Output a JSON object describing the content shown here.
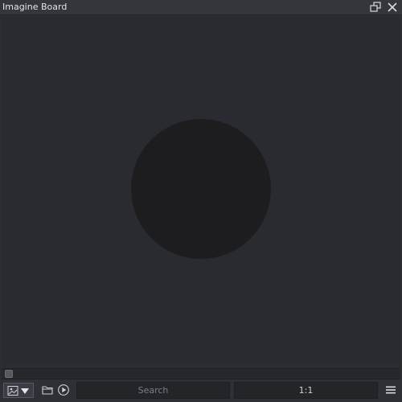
{
  "window": {
    "title": "Imagine Board",
    "float_icon": "float-window-icon",
    "close_icon": "close-icon"
  },
  "viewer": {
    "content": "dark-circle-preview"
  },
  "toolbar": {
    "type_icon": "image-icon",
    "dropdown_icon": "chevron-down-icon",
    "folder_icon": "folder-icon",
    "play_icon": "play-icon",
    "search_placeholder": "Search",
    "zoom_label": "1:1",
    "menu_icon": "hamburger-menu-icon"
  },
  "slider": {
    "position": 0
  },
  "colors": {
    "background": "#2b2d31",
    "titlebar": "#33363b",
    "canvas": "#292b30",
    "circle": "#1d1d1f",
    "text": "#e3e5e8"
  }
}
